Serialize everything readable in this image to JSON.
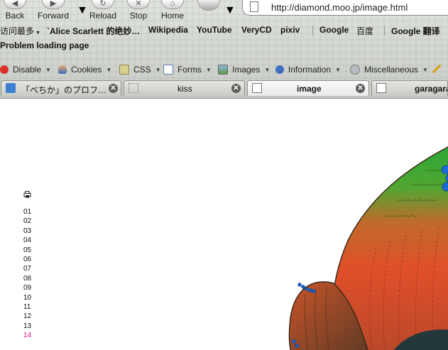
{
  "toolbar": {
    "back_label": "Back",
    "forward_label": "Forward",
    "reload_label": "Reload",
    "stop_label": "Stop",
    "home_label": "Home",
    "url": "http://diamond.moo.jp/image.html"
  },
  "bookmarks": [
    "访问最多",
    "`Alice Scarlett 的绝妙…",
    "Wikipedia",
    "YouTube",
    "VeryCD",
    "pixiv",
    "Google",
    "百度",
    "Google 翻译"
  ],
  "notification": "Problem loading page",
  "devbar": [
    {
      "label": "Disable",
      "icon": "no-entry-icon"
    },
    {
      "label": "Cookies",
      "icon": "person-icon"
    },
    {
      "label": "CSS",
      "icon": "css-icon"
    },
    {
      "label": "Forms",
      "icon": "form-icon"
    },
    {
      "label": "Images",
      "icon": "image-icon"
    },
    {
      "label": "Information",
      "icon": "info-icon"
    },
    {
      "label": "Miscellaneous",
      "icon": "gear-icon"
    }
  ],
  "tabs": [
    {
      "title": "「べちか」のプロフ…",
      "active": false
    },
    {
      "title": "kiss",
      "active": false
    },
    {
      "title": "image",
      "active": true
    },
    {
      "title": "garagara",
      "active": false
    }
  ],
  "page": {
    "items": [
      "01",
      "02",
      "03",
      "04",
      "05",
      "06",
      "07",
      "08",
      "09",
      "10",
      "11",
      "12",
      "13",
      "14"
    ],
    "current_item": "14"
  },
  "colors": {
    "current_link": "#e0108a",
    "art_green": "#2aa23a",
    "art_orange": "#e2502a",
    "art_blue": "#1e6bd6",
    "art_dark": "#22383a"
  }
}
